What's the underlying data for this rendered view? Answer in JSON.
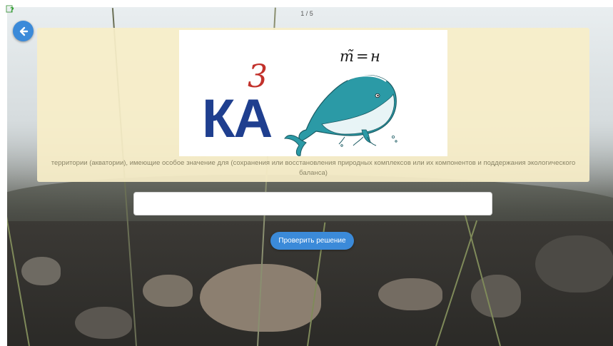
{
  "header": {
    "counter": "1 / 5",
    "hint_icon": "green-question-mark-icon",
    "back_icon": "arrow-left-icon"
  },
  "card": {
    "rebus": {
      "letters": "КА",
      "superscript": "3",
      "equation_left": "т̃",
      "equation_sign": "=",
      "equation_right": "н",
      "picture": "whale-illustration"
    },
    "description": "территории (акватории), имеющие особое значение для (сохранения или восстановления природных комплексов или их компонентов и поддержания экологического баланса)"
  },
  "answer": {
    "value": "",
    "placeholder": ""
  },
  "actions": {
    "check_label": "Проверить решение"
  },
  "colors": {
    "accent": "#3b8ad9",
    "card_bg": "#f7eec8",
    "letters": "#1f3f8f",
    "whale": "#2b9aa6"
  }
}
